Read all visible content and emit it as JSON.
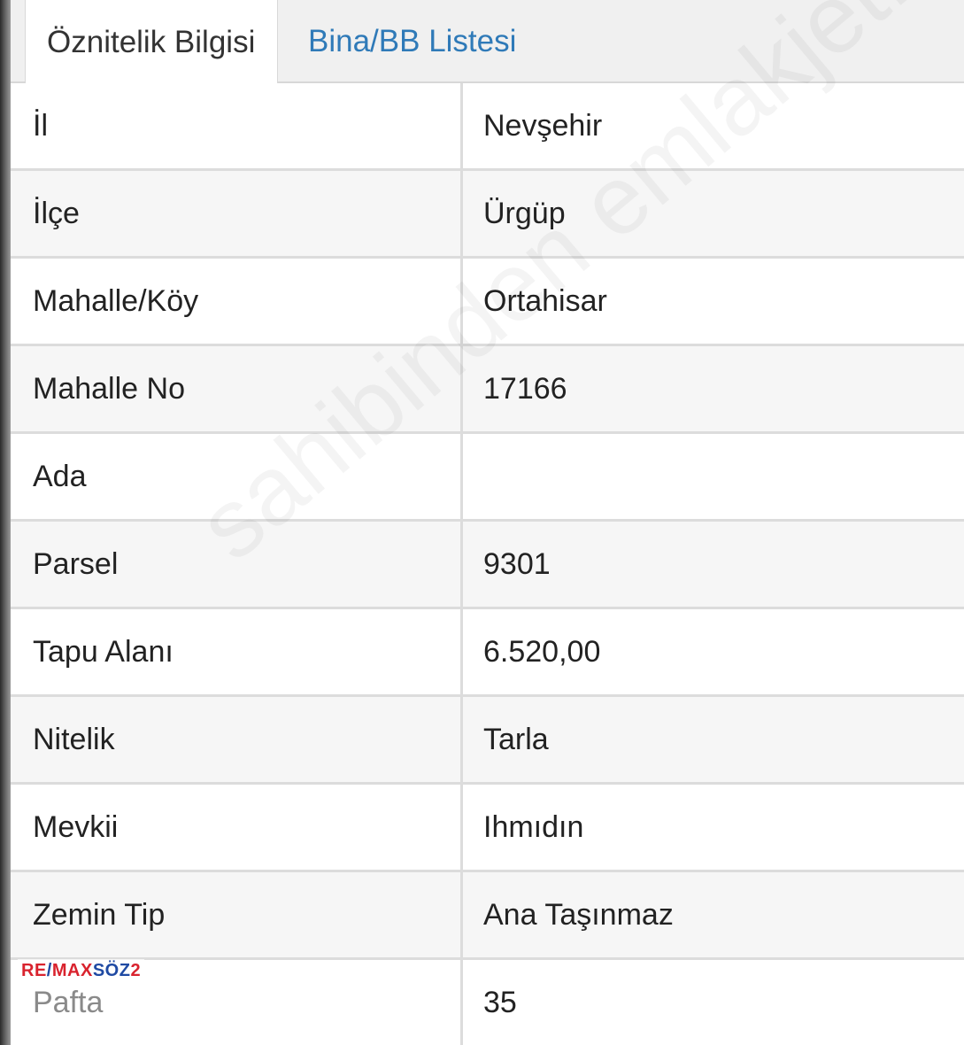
{
  "tabs": [
    {
      "label": "Öznitelik Bilgisi",
      "active": true
    },
    {
      "label": "Bina/BB Listesi",
      "active": false
    }
  ],
  "rows": [
    {
      "label": "İl",
      "value": "Nevşehir"
    },
    {
      "label": "İlçe",
      "value": "Ürgüp"
    },
    {
      "label": "Mahalle/Köy",
      "value": "Ortahisar"
    },
    {
      "label": "Mahalle No",
      "value": "17166"
    },
    {
      "label": "Ada",
      "value": ""
    },
    {
      "label": "Parsel",
      "value": "9301"
    },
    {
      "label": "Tapu Alanı",
      "value": "6.520,00"
    },
    {
      "label": "Nitelik",
      "value": "Tarla"
    },
    {
      "label": "Mevkii",
      "value": "Ihmıdın"
    },
    {
      "label": "Zemin Tip",
      "value": "Ana Taşınmaz"
    },
    {
      "label": "Pafta",
      "value": "35"
    }
  ],
  "watermark": "sahibinden emlakjet.com",
  "logo": {
    "re": "RE",
    "slash": "/",
    "max": "MAX",
    "soz": "SÖZ",
    "two": "2"
  },
  "colors": {
    "tab_link": "#2f7ab8",
    "text": "#222222",
    "logo_red": "#d9232e",
    "logo_blue": "#1f4aa3"
  }
}
